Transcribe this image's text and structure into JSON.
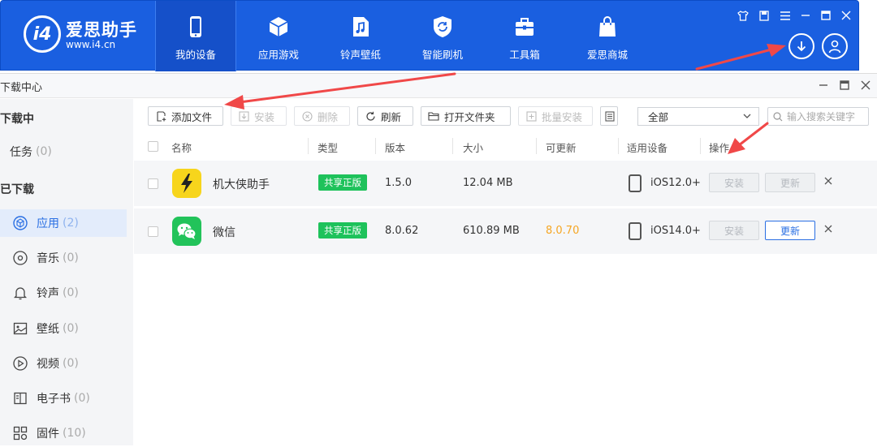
{
  "app": {
    "logo_text": "爱思助手",
    "logo_url": "www.i4.cn",
    "colors": {
      "brand_blue": "#1a5fe0",
      "accent": "#2a6fe3",
      "badge_green": "#1ec25b",
      "update_orange": "#f5a623",
      "arrow_red": "#f04848"
    }
  },
  "nav": {
    "tabs": [
      {
        "label": "我的设备",
        "icon": "phone-icon",
        "active": true
      },
      {
        "label": "应用游戏",
        "icon": "cube-icon",
        "active": false
      },
      {
        "label": "铃声壁纸",
        "icon": "music-file-icon",
        "active": false
      },
      {
        "label": "智能刷机",
        "icon": "refresh-shield-icon",
        "active": false
      },
      {
        "label": "工具箱",
        "icon": "toolbox-icon",
        "active": false
      },
      {
        "label": "爱思商城",
        "icon": "shopping-bag-icon",
        "active": false
      }
    ]
  },
  "download_center": {
    "title": "下载中心",
    "sidebar": {
      "downloading_heading": "下载中",
      "tasks": {
        "label": "任务",
        "count": "(0)"
      },
      "downloaded_heading": "已下载",
      "items": [
        {
          "label": "应用",
          "count": "(2)",
          "icon": "app-cube-icon",
          "active": true
        },
        {
          "label": "音乐",
          "count": "(0)",
          "icon": "disc-icon",
          "active": false
        },
        {
          "label": "铃声",
          "count": "(0)",
          "icon": "bell-icon",
          "active": false
        },
        {
          "label": "壁纸",
          "count": "(0)",
          "icon": "image-icon",
          "active": false
        },
        {
          "label": "视频",
          "count": "(0)",
          "icon": "video-icon",
          "active": false
        },
        {
          "label": "电子书",
          "count": "(0)",
          "icon": "book-icon",
          "active": false
        },
        {
          "label": "固件",
          "count": "(10)",
          "icon": "firmware-grid-icon",
          "active": false
        }
      ]
    },
    "toolbar": {
      "add_file": "添加文件",
      "install": "安装",
      "delete": "删除",
      "refresh": "刷新",
      "open_folder": "打开文件夹",
      "batch_install": "批量安装",
      "filter_value": "全部",
      "search_placeholder": "输入搜索关键字"
    },
    "table": {
      "headers": {
        "name": "名称",
        "type": "类型",
        "version": "版本",
        "size": "大小",
        "updatable": "可更新",
        "device": "适用设备",
        "actions": "操作"
      },
      "rows": [
        {
          "name": "机大侠助手",
          "type": "共享正版",
          "version": "1.5.0",
          "size": "12.04 MB",
          "updatable": "",
          "device": "iOS12.0+",
          "install_label": "安装",
          "update_label": "更新",
          "update_enabled": false
        },
        {
          "name": "微信",
          "type": "共享正版",
          "version": "8.0.62",
          "size": "610.89 MB",
          "updatable": "8.0.70",
          "device": "iOS14.0+",
          "install_label": "安装",
          "update_label": "更新",
          "update_enabled": true
        }
      ]
    }
  }
}
